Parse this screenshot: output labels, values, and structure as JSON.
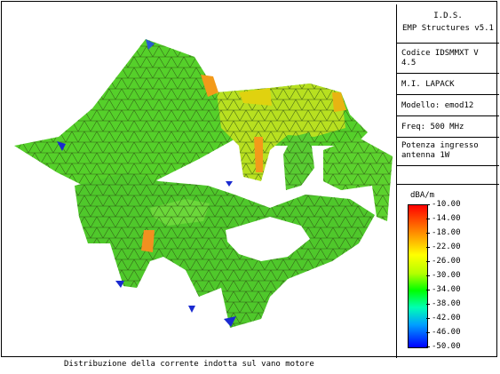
{
  "header": {
    "line1": "I.D.S.",
    "line2": "EMP Structures v5.1"
  },
  "info": {
    "code": "Codice IDSMMXT V 4.5",
    "solver": "M.I. LAPACK",
    "model": "Modello: emod12",
    "freq": "Freq: 500 MHz",
    "power": "Potenza ingresso antenna 1W"
  },
  "colorbar": {
    "unit": "dBA/m",
    "labels": [
      "-10.00",
      "-14.00",
      "-18.00",
      "-22.00",
      "-26.00",
      "-30.00",
      "-34.00",
      "-38.00",
      "-42.00",
      "-46.00",
      "-50.00"
    ],
    "colors": {
      "max": "#ff0000",
      "mid": "#00ff00",
      "min": "#0000ff"
    }
  },
  "caption": "Distribuzione della corrente indotta sul vano motore"
}
